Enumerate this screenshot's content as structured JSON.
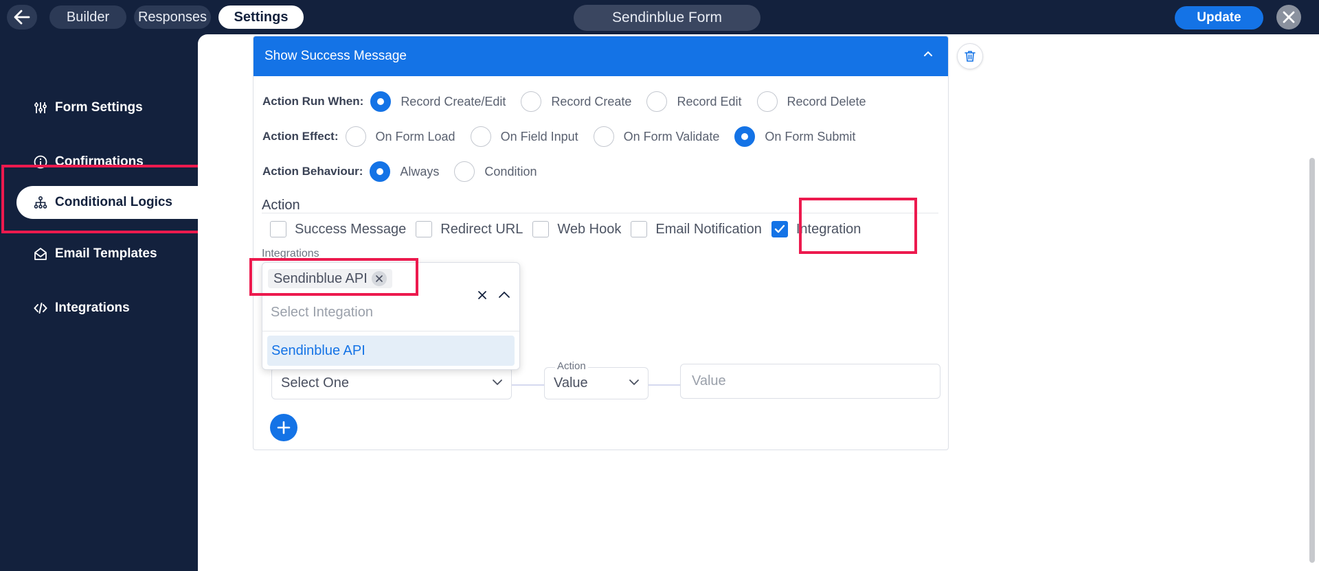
{
  "topbar": {
    "tabs": [
      {
        "label": "Builder"
      },
      {
        "label": "Responses"
      },
      {
        "label": "Settings"
      }
    ],
    "form_title": "Sendinblue Form",
    "update_label": "Update"
  },
  "sidebar": {
    "items": [
      {
        "label": "Form Settings",
        "icon": "sliders-icon"
      },
      {
        "label": "Confirmations",
        "icon": "info-icon"
      },
      {
        "label": "Conditional Logics",
        "icon": "sitemap-icon",
        "active": true
      },
      {
        "label": "Email Templates",
        "icon": "envelope-open-icon"
      },
      {
        "label": "Integrations",
        "icon": "code-icon"
      }
    ]
  },
  "card": {
    "title": "Show Success Message",
    "run_when": {
      "label": "Action Run When:",
      "options": [
        "Record Create/Edit",
        "Record Create",
        "Record Edit",
        "Record Delete"
      ],
      "selected": "Record Create/Edit"
    },
    "effect": {
      "label": "Action Effect:",
      "options": [
        "On Form Load",
        "On Field Input",
        "On Form Validate",
        "On Form Submit"
      ],
      "selected": "On Form Submit"
    },
    "behaviour": {
      "label": "Action Behaviour:",
      "options": [
        "Always",
        "Condition"
      ],
      "selected": "Always"
    },
    "action": {
      "title": "Action",
      "checkboxes": [
        {
          "label": "Success Message",
          "checked": false
        },
        {
          "label": "Redirect URL",
          "checked": false
        },
        {
          "label": "Web Hook",
          "checked": false
        },
        {
          "label": "Email Notification",
          "checked": false
        },
        {
          "label": "Integration",
          "checked": true
        }
      ]
    },
    "integrations": {
      "label": "Integrations",
      "selected_tag": "Sendinblue API",
      "search_placeholder": "Select Integation",
      "options": [
        "Sendinblue API"
      ]
    },
    "condition": {
      "field_value": "Select One",
      "action_legend": "Action",
      "action_value": "Value",
      "value_placeholder": "Value"
    }
  },
  "colors": {
    "primary": "#1473e6",
    "sidebar_bg": "#13213d",
    "highlight": "#ec1a4e"
  }
}
